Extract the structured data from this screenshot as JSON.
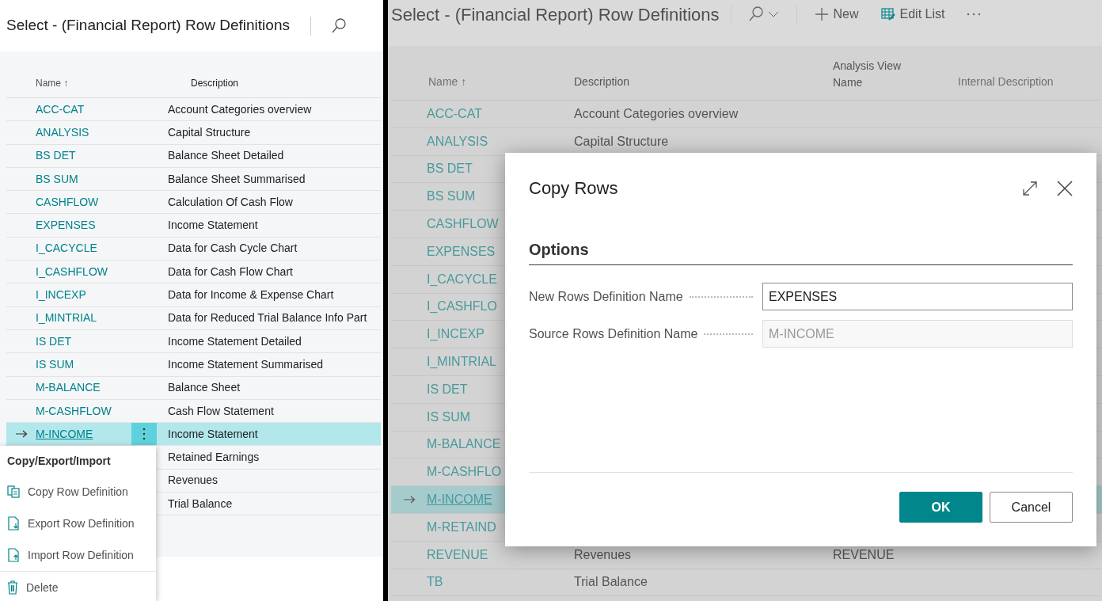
{
  "left_page": {
    "title": "Select - (Financial Report) Row Definitions",
    "columns": [
      {
        "label": "Name",
        "sort_indicator": "↑"
      },
      {
        "label": "Description"
      }
    ],
    "rows": [
      {
        "name": "ACC-CAT",
        "description": "Account Categories overview",
        "selected": false
      },
      {
        "name": "ANALYSIS",
        "description": "Capital Structure",
        "selected": false
      },
      {
        "name": "BS DET",
        "description": "Balance Sheet Detailed",
        "selected": false
      },
      {
        "name": "BS SUM",
        "description": "Balance Sheet Summarised",
        "selected": false
      },
      {
        "name": "CASHFLOW",
        "description": "Calculation Of Cash Flow",
        "selected": false
      },
      {
        "name": "EXPENSES",
        "description": "Income Statement",
        "selected": false
      },
      {
        "name": "I_CACYCLE",
        "description": "Data for Cash Cycle Chart",
        "selected": false
      },
      {
        "name": "I_CASHFLOW",
        "description": "Data for Cash Flow Chart",
        "selected": false
      },
      {
        "name": "I_INCEXP",
        "description": "Data for Income & Expense Chart",
        "selected": false
      },
      {
        "name": "I_MINTRIAL",
        "description": "Data for Reduced Trial Balance Info Part",
        "selected": false
      },
      {
        "name": "IS DET",
        "description": "Income Statement Detailed",
        "selected": false
      },
      {
        "name": "IS SUM",
        "description": "Income Statement Summarised",
        "selected": false
      },
      {
        "name": "M-BALANCE",
        "description": "Balance Sheet",
        "selected": false
      },
      {
        "name": "M-CASHFLOW",
        "description": "Cash Flow Statement",
        "selected": false
      },
      {
        "name": "M-INCOME",
        "description": "Income Statement",
        "selected": true
      },
      {
        "description": "Retained Earnings",
        "selected": false
      },
      {
        "description": "Revenues",
        "selected": false
      },
      {
        "description": "Trial Balance",
        "selected": false
      }
    ],
    "context_menu": {
      "title": "Copy/Export/Import",
      "items": [
        {
          "kind": "copy",
          "label": "Copy Row Definition"
        },
        {
          "kind": "export",
          "label": "Export Row Definition"
        },
        {
          "kind": "import",
          "label": "Import Row Definition"
        },
        {
          "kind": "delete",
          "label": "Delete"
        }
      ]
    }
  },
  "right_page": {
    "title": "Select - (Financial Report) Row Definitions",
    "toolbar": [
      {
        "kind": "search"
      },
      {
        "kind": "new",
        "label": "New"
      },
      {
        "kind": "edit_list",
        "label": "Edit List"
      },
      {
        "kind": "more"
      }
    ],
    "columns": [
      {
        "label": "Name",
        "sort_indicator": "↑"
      },
      {
        "label": "Description"
      },
      {
        "label": "Analysis View Name"
      },
      {
        "label": "Internal Description"
      }
    ],
    "rows": [
      {
        "name": "ACC-CAT",
        "description": "Account Categories overview",
        "selected": false
      },
      {
        "name": "ANALYSIS",
        "description": "Capital Structure",
        "selected": false
      },
      {
        "name": "BS DET",
        "selected": false
      },
      {
        "name": "BS SUM",
        "selected": false
      },
      {
        "name": "CASHFLOW",
        "selected": false
      },
      {
        "name": "EXPENSES",
        "selected": false
      },
      {
        "name": "I_CACYCLE",
        "selected": false
      },
      {
        "name": "I_CASHFLO",
        "selected": false
      },
      {
        "name": "I_INCEXP",
        "selected": false
      },
      {
        "name": "I_MINTRIAL",
        "selected": false
      },
      {
        "name": "IS DET",
        "selected": false
      },
      {
        "name": "IS SUM",
        "selected": false
      },
      {
        "name": "M-BALANCE",
        "selected": false
      },
      {
        "name": "M-CASHFLO",
        "selected": false
      },
      {
        "name": "M-INCOME",
        "selected": true
      },
      {
        "name": "M-RETAIND",
        "selected": false
      },
      {
        "name": "REVENUE",
        "description": "Revenues",
        "analysis_view_name": "REVENUE",
        "selected": false
      },
      {
        "name": "TB",
        "description": "Trial Balance",
        "selected": false
      }
    ],
    "dialog": {
      "title": "Copy Rows",
      "section": "Options",
      "fields": [
        {
          "label": "New Rows Definition Name",
          "value": "EXPENSES",
          "disabled": false
        },
        {
          "label": "Source Rows Definition Name",
          "value": "M-INCOME",
          "disabled": true
        }
      ],
      "buttons": [
        {
          "label": "OK",
          "primary": true
        },
        {
          "label": "Cancel",
          "primary": false
        }
      ]
    }
  }
}
